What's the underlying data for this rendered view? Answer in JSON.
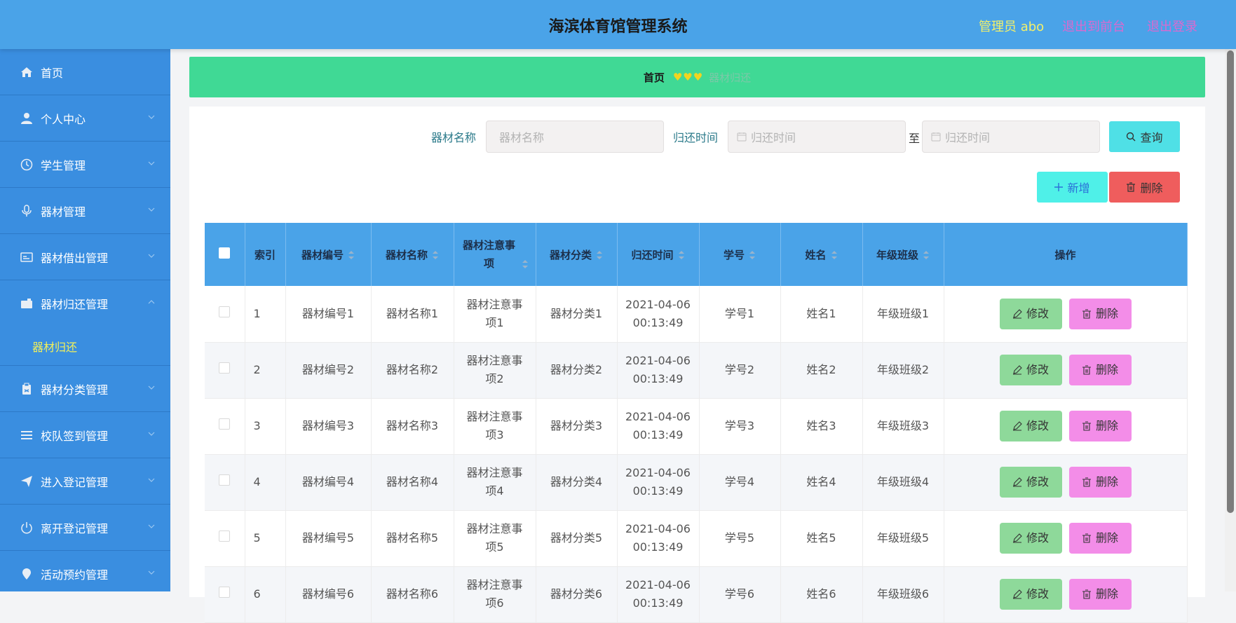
{
  "header": {
    "title": "海滨体育馆管理系统",
    "role_label": "管理员 abo",
    "to_front_label": "退出到前台",
    "logout_label": "退出登录"
  },
  "sidebar": {
    "items": [
      {
        "label": "首页",
        "icon": "home-icon"
      },
      {
        "label": "个人中心",
        "icon": "user-icon"
      },
      {
        "label": "学生管理",
        "icon": "clock-icon"
      },
      {
        "label": "器材管理",
        "icon": "mic-icon"
      },
      {
        "label": "器材借出管理",
        "icon": "card-icon"
      },
      {
        "label": "器材归还管理",
        "icon": "camera-icon",
        "sub": "器材归还"
      },
      {
        "label": "器材分类管理",
        "icon": "clipboard-icon"
      },
      {
        "label": "校队签到管理",
        "icon": "list-icon"
      },
      {
        "label": "进入登记管理",
        "icon": "send-icon"
      },
      {
        "label": "离开登记管理",
        "icon": "power-icon"
      },
      {
        "label": "活动预约管理",
        "icon": "location-icon"
      }
    ]
  },
  "breadcrumb": {
    "home": "首页",
    "hearts": "♥♥♥",
    "current": "器材归还"
  },
  "search": {
    "name_label": "器材名称",
    "name_placeholder": "器材名称",
    "time_label": "归还时间",
    "time_from_placeholder": "归还时间",
    "to_label": "至",
    "time_to_placeholder": "归还时间",
    "query_label": "查询"
  },
  "actions": {
    "add_label": "新增",
    "delete_label": "删除"
  },
  "table": {
    "columns": [
      "索引",
      "器材编号",
      "器材名称",
      "器材注意事项",
      "器材分类",
      "归还时间",
      "学号",
      "姓名",
      "年级班级",
      "操作"
    ],
    "edit_label": "修改",
    "delete_label": "删除",
    "rows": [
      {
        "index": "1",
        "code": "器材编号1",
        "name": "器材名称1",
        "note": "器材注意事项1",
        "category": "器材分类1",
        "date": "2021-04-06",
        "time": "00:13:49",
        "sid": "学号1",
        "sname": "姓名1",
        "klass": "年级班级1"
      },
      {
        "index": "2",
        "code": "器材编号2",
        "name": "器材名称2",
        "note": "器材注意事项2",
        "category": "器材分类2",
        "date": "2021-04-06",
        "time": "00:13:49",
        "sid": "学号2",
        "sname": "姓名2",
        "klass": "年级班级2"
      },
      {
        "index": "3",
        "code": "器材编号3",
        "name": "器材名称3",
        "note": "器材注意事项3",
        "category": "器材分类3",
        "date": "2021-04-06",
        "time": "00:13:49",
        "sid": "学号3",
        "sname": "姓名3",
        "klass": "年级班级3"
      },
      {
        "index": "4",
        "code": "器材编号4",
        "name": "器材名称4",
        "note": "器材注意事项4",
        "category": "器材分类4",
        "date": "2021-04-06",
        "time": "00:13:49",
        "sid": "学号4",
        "sname": "姓名4",
        "klass": "年级班级4"
      },
      {
        "index": "5",
        "code": "器材编号5",
        "name": "器材名称5",
        "note": "器材注意事项5",
        "category": "器材分类5",
        "date": "2021-04-06",
        "time": "00:13:49",
        "sid": "学号5",
        "sname": "姓名5",
        "klass": "年级班级5"
      },
      {
        "index": "6",
        "code": "器材编号6",
        "name": "器材名称6",
        "note": "器材注意事项6",
        "category": "器材分类6",
        "date": "2021-04-06",
        "time": "00:13:49",
        "sid": "学号6",
        "sname": "姓名6",
        "klass": "年级班级6"
      }
    ]
  },
  "colors": {
    "header_bg": "#4aa3e8",
    "sidebar_bg": "#3a8ee0",
    "breadcrumb_bg": "#40d995",
    "query_btn": "#4fe0e6",
    "add_btn": "#4ff0e8",
    "delete_btn": "#ef5d5d",
    "edit_btn": "#8ed99a",
    "row_delete_btn": "#f38de8",
    "active_sub": "#f2f05a"
  }
}
